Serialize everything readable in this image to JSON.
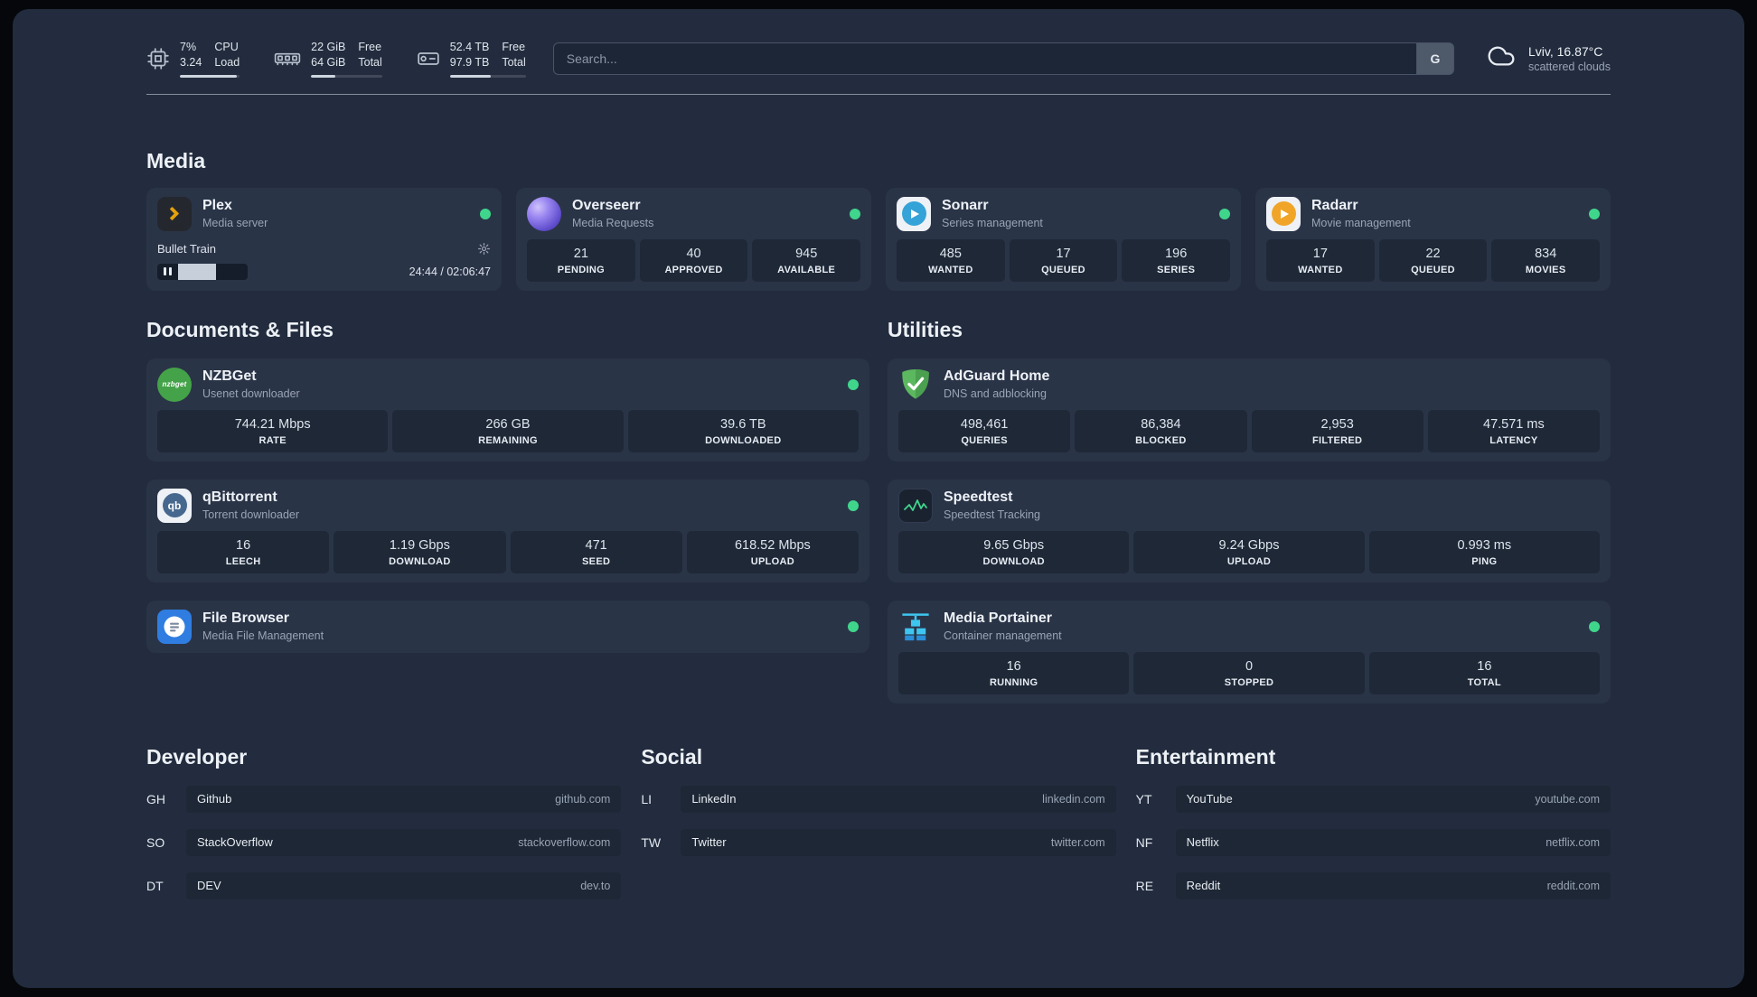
{
  "topbar": {
    "cpu": {
      "value_top": "7%",
      "value_bottom": "3.24",
      "label_top": "CPU",
      "label_bottom": "Load",
      "bar_percent": 95
    },
    "ram": {
      "value_top": "22 GiB",
      "value_bottom": "64 GiB",
      "label_top": "Free",
      "label_bottom": "Total",
      "bar_percent": 34
    },
    "disk": {
      "value_top": "52.4 TB",
      "value_bottom": "97.9 TB",
      "label_top": "Free",
      "label_bottom": "Total",
      "bar_percent": 54
    },
    "search": {
      "placeholder": "Search...",
      "button_label": "G"
    },
    "weather": {
      "location": "Lviv, 16.87°C",
      "condition": "scattered clouds"
    }
  },
  "sections": {
    "media": {
      "heading": "Media",
      "plex": {
        "title": "Plex",
        "subtitle": "Media server",
        "now_playing": "Bullet Train",
        "time": "24:44 / 02:06:47",
        "progress_percent": 55
      },
      "overseerr": {
        "title": "Overseerr",
        "subtitle": "Media Requests",
        "stats": [
          {
            "value": "21",
            "label": "PENDING"
          },
          {
            "value": "40",
            "label": "APPROVED"
          },
          {
            "value": "945",
            "label": "AVAILABLE"
          }
        ]
      },
      "sonarr": {
        "title": "Sonarr",
        "subtitle": "Series management",
        "stats": [
          {
            "value": "485",
            "label": "WANTED"
          },
          {
            "value": "17",
            "label": "QUEUED"
          },
          {
            "value": "196",
            "label": "SERIES"
          }
        ]
      },
      "radarr": {
        "title": "Radarr",
        "subtitle": "Movie management",
        "stats": [
          {
            "value": "17",
            "label": "WANTED"
          },
          {
            "value": "22",
            "label": "QUEUED"
          },
          {
            "value": "834",
            "label": "MOVIES"
          }
        ]
      }
    },
    "documents": {
      "heading": "Documents & Files",
      "nzbget": {
        "title": "NZBGet",
        "subtitle": "Usenet downloader",
        "icon_text": "nzbget",
        "stats": [
          {
            "value": "744.21 Mbps",
            "label": "RATE"
          },
          {
            "value": "266 GB",
            "label": "REMAINING"
          },
          {
            "value": "39.6 TB",
            "label": "DOWNLOADED"
          }
        ]
      },
      "qbittorrent": {
        "title": "qBittorrent",
        "subtitle": "Torrent downloader",
        "icon_text": "qb",
        "stats": [
          {
            "value": "16",
            "label": "LEECH"
          },
          {
            "value": "1.19 Gbps",
            "label": "DOWNLOAD"
          },
          {
            "value": "471",
            "label": "SEED"
          },
          {
            "value": "618.52 Mbps",
            "label": "UPLOAD"
          }
        ]
      },
      "filebrowser": {
        "title": "File Browser",
        "subtitle": "Media File Management"
      }
    },
    "utilities": {
      "heading": "Utilities",
      "adguard": {
        "title": "AdGuard Home",
        "subtitle": "DNS and adblocking",
        "stats": [
          {
            "value": "498,461",
            "label": "QUERIES"
          },
          {
            "value": "86,384",
            "label": "BLOCKED"
          },
          {
            "value": "2,953",
            "label": "FILTERED"
          },
          {
            "value": "47.571 ms",
            "label": "LATENCY"
          }
        ]
      },
      "speedtest": {
        "title": "Speedtest",
        "subtitle": "Speedtest Tracking",
        "stats": [
          {
            "value": "9.65 Gbps",
            "label": "DOWNLOAD"
          },
          {
            "value": "9.24 Gbps",
            "label": "UPLOAD"
          },
          {
            "value": "0.993 ms",
            "label": "PING"
          }
        ]
      },
      "portainer": {
        "title": "Media Portainer",
        "subtitle": "Container management",
        "stats": [
          {
            "value": "16",
            "label": "RUNNING"
          },
          {
            "value": "0",
            "label": "STOPPED"
          },
          {
            "value": "16",
            "label": "TOTAL"
          }
        ]
      }
    },
    "bookmarks": [
      {
        "heading": "Developer",
        "items": [
          {
            "abbr": "GH",
            "name": "Github",
            "url": "github.com"
          },
          {
            "abbr": "SO",
            "name": "StackOverflow",
            "url": "stackoverflow.com"
          },
          {
            "abbr": "DT",
            "name": "DEV",
            "url": "dev.to"
          }
        ]
      },
      {
        "heading": "Social",
        "items": [
          {
            "abbr": "LI",
            "name": "LinkedIn",
            "url": "linkedin.com"
          },
          {
            "abbr": "TW",
            "name": "Twitter",
            "url": "twitter.com"
          }
        ]
      },
      {
        "heading": "Entertainment",
        "items": [
          {
            "abbr": "YT",
            "name": "YouTube",
            "url": "youtube.com"
          },
          {
            "abbr": "NF",
            "name": "Netflix",
            "url": "netflix.com"
          },
          {
            "abbr": "RE",
            "name": "Reddit",
            "url": "reddit.com"
          }
        ]
      }
    ]
  },
  "colors": {
    "accent_green": "#3fd68c",
    "background": "#222c3e"
  }
}
